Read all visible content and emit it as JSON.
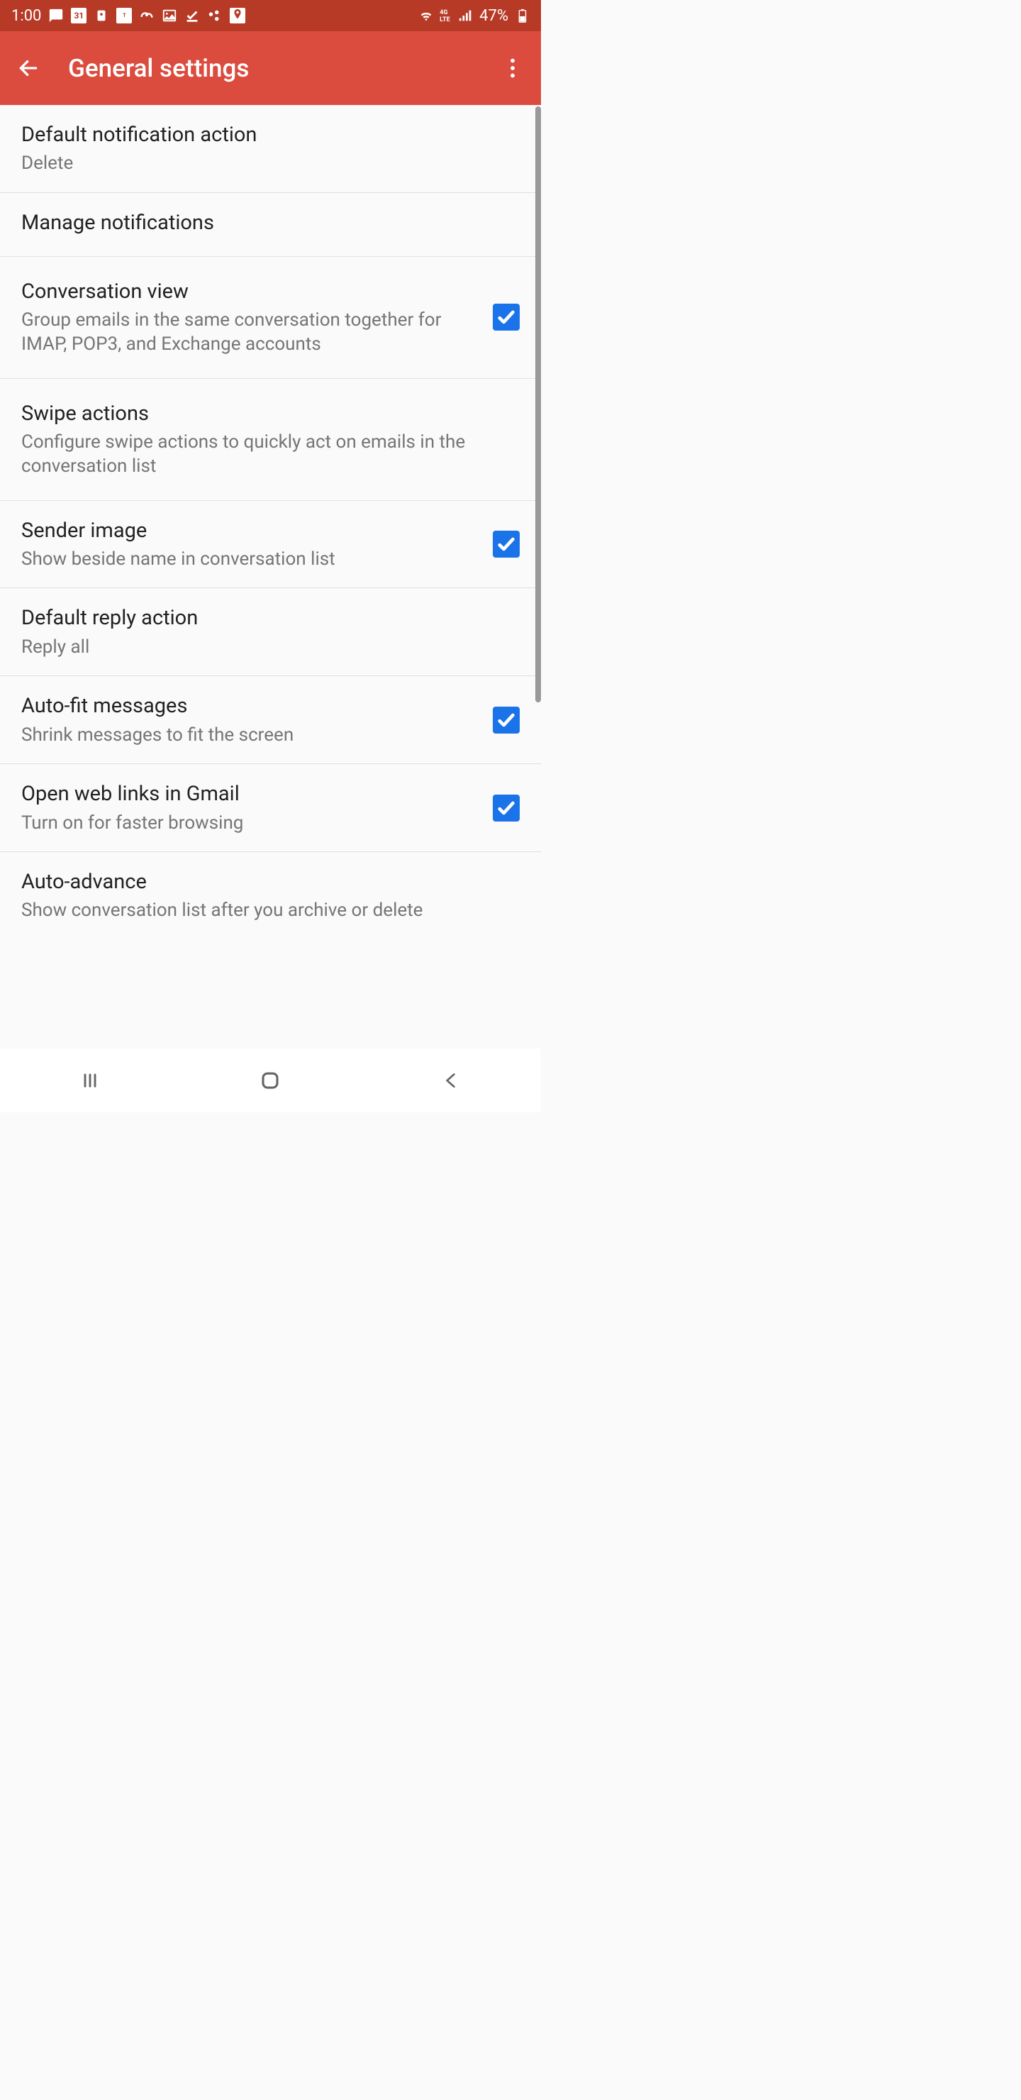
{
  "statusBar": {
    "time": "1:00",
    "battery": "47%"
  },
  "appBar": {
    "title": "General settings"
  },
  "settings": [
    {
      "title": "Default notification action",
      "sub": "Delete",
      "checkbox": false
    },
    {
      "title": "Manage notifications",
      "sub": "",
      "checkbox": false
    },
    {
      "title": "Conversation view",
      "sub": "Group emails in the same conversation together for IMAP, POP3, and Exchange accounts",
      "checkbox": true
    },
    {
      "title": "Swipe actions",
      "sub": "Configure swipe actions to quickly act on emails in the conversation list",
      "checkbox": false
    },
    {
      "title": "Sender image",
      "sub": "Show beside name in conversation list",
      "checkbox": true
    },
    {
      "title": "Default reply action",
      "sub": "Reply all",
      "checkbox": false
    },
    {
      "title": "Auto-fit messages",
      "sub": "Shrink messages to fit the screen",
      "checkbox": true
    },
    {
      "title": "Open web links in Gmail",
      "sub": "Turn on for faster browsing",
      "checkbox": true
    },
    {
      "title": "Auto-advance",
      "sub": "Show conversation list after you archive or delete",
      "checkbox": false
    }
  ]
}
